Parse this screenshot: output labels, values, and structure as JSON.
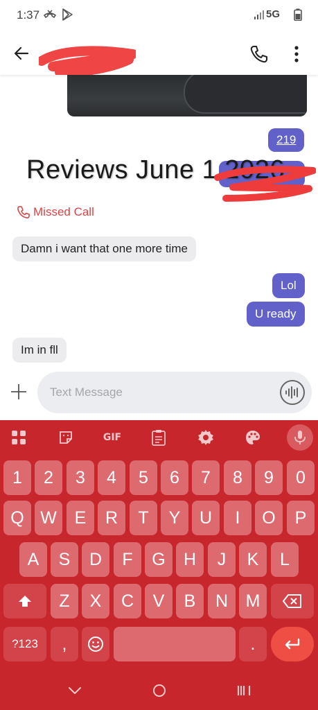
{
  "status_bar": {
    "time": "1:37",
    "network": "5G"
  },
  "header": {
    "contact_name": ""
  },
  "messages": {
    "link_219": "219",
    "overlay_text": "Reviews June 1 2026",
    "missed_call": "Missed Call",
    "incoming_1": "Damn i want that one more time",
    "outgoing_1": "Lol",
    "outgoing_2": "U ready",
    "incoming_2": "Im in fll"
  },
  "compose": {
    "placeholder": "Text Message"
  },
  "keyboard": {
    "toolbar": {
      "gif": "GIF"
    },
    "row_numbers": [
      "1",
      "2",
      "3",
      "4",
      "5",
      "6",
      "7",
      "8",
      "9",
      "0"
    ],
    "row_1": [
      "Q",
      "W",
      "E",
      "R",
      "T",
      "Y",
      "U",
      "I",
      "O",
      "P"
    ],
    "row_2": [
      "A",
      "S",
      "D",
      "F",
      "G",
      "H",
      "J",
      "K",
      "L"
    ],
    "row_3": [
      "Z",
      "X",
      "C",
      "V",
      "B",
      "N",
      "M"
    ],
    "symbols_key": "?123",
    "comma_key": ",",
    "period_key": "."
  },
  "colors": {
    "accent": "#6161c9",
    "keyboard_bg": "#c8262d",
    "key_bg": "#dd6a6f",
    "missed_call": "#d94545",
    "redaction": "#ee3b3b"
  }
}
